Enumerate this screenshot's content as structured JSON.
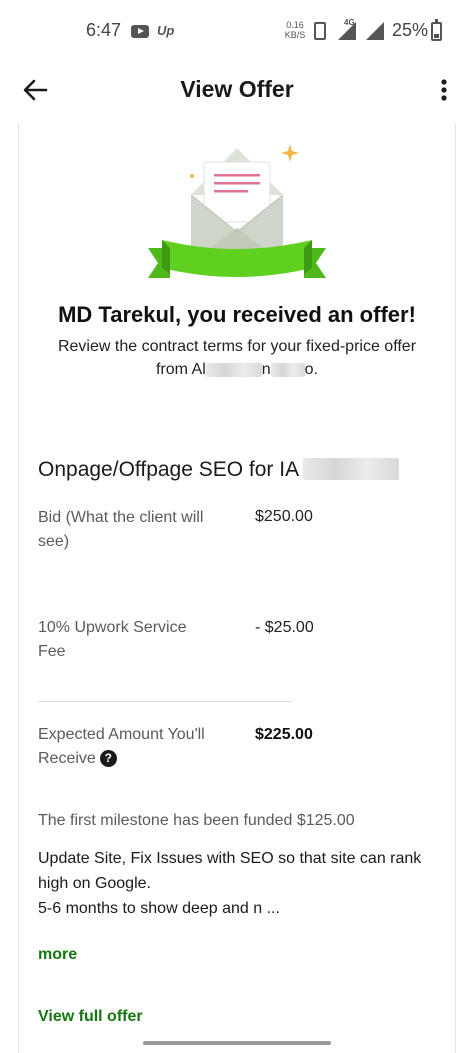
{
  "status_bar": {
    "time": "6:47",
    "up_badge": "Up",
    "net_speed_value": "0.16",
    "net_speed_unit": "KB/S",
    "network_type": "4G",
    "battery": "25%"
  },
  "header": {
    "title": "View Offer",
    "back_icon": "arrow-left-icon",
    "menu_icon": "more-vertical-icon"
  },
  "offer": {
    "headline": "MD Tarekul, you received an offer!",
    "subline_part1": "Review the contract terms for your fixed-price offer from Al",
    "subline_part2": "n",
    "subline_part3": "o.",
    "title_prefix": "Onpage/Offpage SEO for IA"
  },
  "terms": {
    "bid_label": "Bid (What the client will see)",
    "bid_value": "$250.00",
    "fee_label": "10% Upwork Service Fee",
    "fee_value": "- $25.00",
    "expected_label": "Expected Amount You'll Receive",
    "expected_value": "$225.00"
  },
  "milestone": "The first milestone has been funded $125.00",
  "description": {
    "line1": "Update Site, Fix Issues with SEO so that site can rank high on Google.",
    "line2": "5-6 months to show deep and n ..."
  },
  "links": {
    "more": "more",
    "view_full_offer": "View full offer"
  },
  "colors": {
    "accent_green": "#14780f",
    "ribbon_green": "#5fd01f",
    "sparkle": "#f0b64a",
    "letter_lines": "#e3748f"
  }
}
